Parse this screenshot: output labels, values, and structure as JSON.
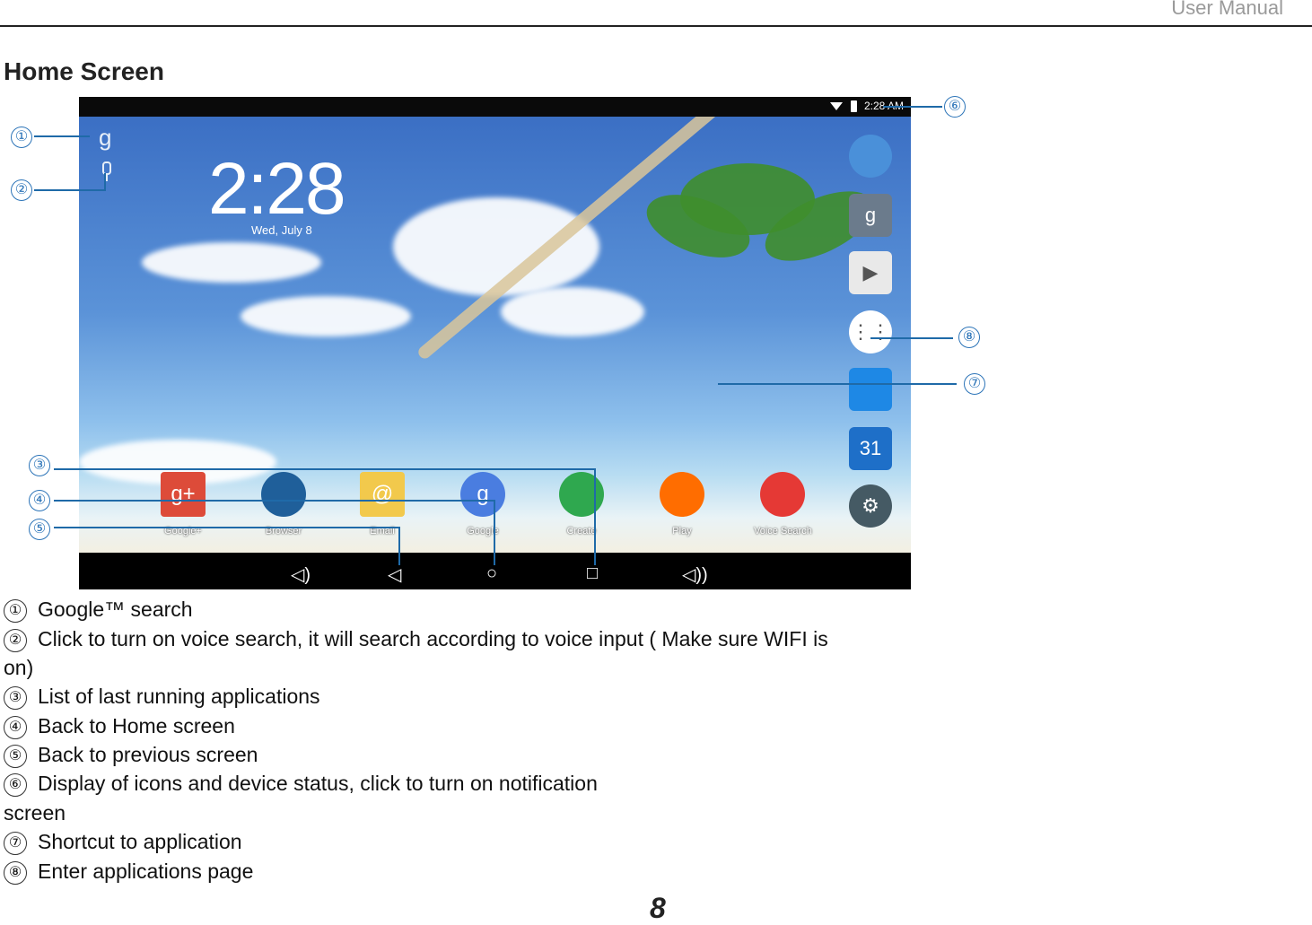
{
  "header": {
    "doc_title": "User Manual",
    "section_title": "Home Screen"
  },
  "screenshot": {
    "status_time": "2:28 AM",
    "clock": "2:28",
    "date": "Wed, July 8",
    "google_glyph": "g",
    "apps": [
      {
        "label": "Google+",
        "icon": "google-plus-icon",
        "color": "#dd4b39",
        "glyph": "g+"
      },
      {
        "label": "Browser",
        "icon": "globe-icon",
        "color": "#1f5f9a",
        "glyph": ""
      },
      {
        "label": "Email",
        "icon": "envelope-icon",
        "color": "#f2c94c",
        "glyph": "@"
      },
      {
        "label": "Google",
        "icon": "google-icon",
        "color": "#4a7de0",
        "glyph": "g"
      },
      {
        "label": "Create",
        "icon": "drive-icon",
        "color": "#2fa84f",
        "glyph": ""
      },
      {
        "label": "Play",
        "icon": "play-music-icon",
        "color": "#ff6d00",
        "glyph": ""
      },
      {
        "label": "Voice Search",
        "icon": "microphone-icon",
        "color": "#e53935",
        "glyph": ""
      }
    ],
    "dock": [
      {
        "icon": "chrome-icon",
        "glyph": ""
      },
      {
        "icon": "google-settings-icon",
        "glyph": "g"
      },
      {
        "icon": "play-store-icon",
        "glyph": "▶"
      },
      {
        "icon": "app-drawer-icon",
        "glyph": "⋮⋮"
      },
      {
        "icon": "contacts-icon",
        "glyph": ""
      },
      {
        "icon": "calendar-icon",
        "glyph": "31"
      },
      {
        "icon": "settings-icon",
        "glyph": "⚙"
      }
    ],
    "nav": {
      "volume_down": "◁)",
      "back": "◁",
      "home": "○",
      "recents": "□",
      "volume_up": "◁))"
    }
  },
  "callouts": [
    "①",
    "②",
    "③",
    "④",
    "⑤",
    "⑥",
    "⑦",
    "⑧"
  ],
  "legend": [
    {
      "num": "①",
      "text": "Google™ search"
    },
    {
      "num": "②",
      "text": "Click to turn on voice search, it will search according to voice input ( Make sure WIFI is"
    },
    {
      "num": "",
      "text": "on)"
    },
    {
      "num": "③",
      "text": "List of last running applications"
    },
    {
      "num": "④",
      "text": "Back to Home screen"
    },
    {
      "num": "⑤",
      "text": "Back to previous screen"
    },
    {
      "num": "⑥",
      "text": "Display of icons and device status, click to turn on notification"
    },
    {
      "num": "",
      "text": "screen"
    },
    {
      "num": "⑦",
      "text": "Shortcut to application"
    },
    {
      "num": "⑧",
      "text": "Enter applications page"
    }
  ],
  "page_number": "8"
}
